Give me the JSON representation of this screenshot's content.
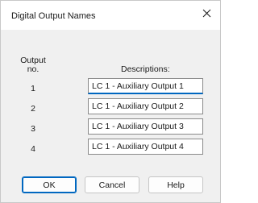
{
  "window": {
    "title": "Digital Output Names",
    "close_glyph": "✕"
  },
  "headers": {
    "output_no": "Output\nno.",
    "descriptions": "Descriptions:"
  },
  "rows": [
    {
      "no": "1",
      "description": "LC 1 - Auxiliary Output 1"
    },
    {
      "no": "2",
      "description": "LC 1 - Auxiliary Output 2"
    },
    {
      "no": "3",
      "description": "LC 1 - Auxiliary Output 3"
    },
    {
      "no": "4",
      "description": "LC 1 - Auxiliary Output 4"
    }
  ],
  "buttons": {
    "ok": "OK",
    "cancel": "Cancel",
    "help": "Help"
  },
  "colors": {
    "focus_accent": "#0067c0",
    "dialog_bg": "#f0f0f0"
  }
}
